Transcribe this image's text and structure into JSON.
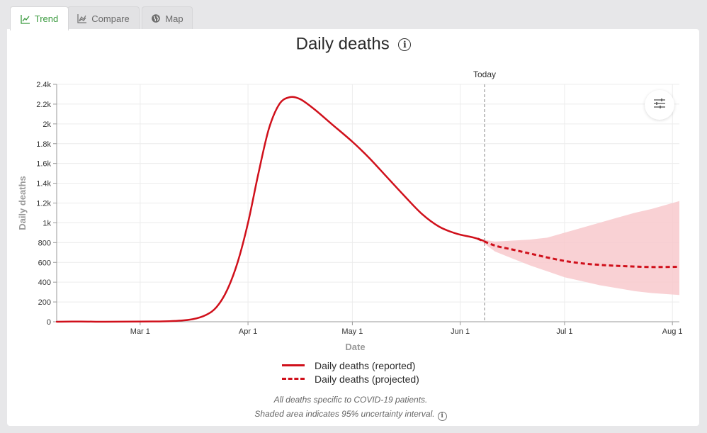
{
  "tabs": [
    {
      "label": "Trend",
      "icon": "line-chart-icon",
      "active": true
    },
    {
      "label": "Compare",
      "icon": "compare-chart-icon",
      "active": false
    },
    {
      "label": "Map",
      "icon": "globe-icon",
      "active": false
    }
  ],
  "title": "Daily deaths",
  "title_info_icon": "info-icon",
  "settings_icon": "sliders-icon",
  "footnotes": {
    "line1": "All deaths specific to COVID-19 patients.",
    "line2": "Shaded area indicates 95% uncertainty interval."
  },
  "colors": {
    "series": "#d0101b",
    "band": "#f8c9cc",
    "active_tab": "#3a9a3e"
  },
  "chart_data": {
    "type": "line",
    "title": "Daily deaths",
    "xlabel": "Date",
    "ylabel": "Daily deaths",
    "x_type": "date",
    "xlim": [
      "2020-02-06",
      "2020-08-03"
    ],
    "ylim": [
      0,
      2400
    ],
    "yticks": [
      0,
      200,
      400,
      600,
      800,
      1000,
      1200,
      1400,
      1600,
      1800,
      2000,
      2200,
      2400
    ],
    "ytick_labels": [
      "0",
      "200",
      "400",
      "600",
      "800",
      "1k",
      "1.2k",
      "1.4k",
      "1.6k",
      "1.8k",
      "2k",
      "2.2k",
      "2.4k"
    ],
    "xticks": [
      "2020-03-01",
      "2020-04-01",
      "2020-05-01",
      "2020-06-01",
      "2020-07-01",
      "2020-08-01"
    ],
    "xtick_labels": [
      "Mar 1",
      "Apr 1",
      "May 1",
      "Jun 1",
      "Jul 1",
      "Aug 1"
    ],
    "today": {
      "date": "2020-06-08",
      "label": "Today"
    },
    "grid": true,
    "legend_position": "bottom",
    "series": [
      {
        "name": "Daily deaths (reported)",
        "style": "solid",
        "points": [
          [
            "2020-02-06",
            0
          ],
          [
            "2020-02-13",
            2
          ],
          [
            "2020-02-20",
            0
          ],
          [
            "2020-03-01",
            2
          ],
          [
            "2020-03-06",
            3
          ],
          [
            "2020-03-11",
            8
          ],
          [
            "2020-03-16",
            25
          ],
          [
            "2020-03-20",
            70
          ],
          [
            "2020-03-23",
            150
          ],
          [
            "2020-03-26",
            320
          ],
          [
            "2020-03-29",
            600
          ],
          [
            "2020-04-01",
            1000
          ],
          [
            "2020-04-04",
            1500
          ],
          [
            "2020-04-07",
            1950
          ],
          [
            "2020-04-10",
            2200
          ],
          [
            "2020-04-13",
            2270
          ],
          [
            "2020-04-16",
            2250
          ],
          [
            "2020-04-20",
            2150
          ],
          [
            "2020-04-25",
            2000
          ],
          [
            "2020-05-01",
            1820
          ],
          [
            "2020-05-06",
            1650
          ],
          [
            "2020-05-11",
            1460
          ],
          [
            "2020-05-16",
            1270
          ],
          [
            "2020-05-21",
            1090
          ],
          [
            "2020-05-26",
            960
          ],
          [
            "2020-05-31",
            890
          ],
          [
            "2020-06-05",
            850
          ],
          [
            "2020-06-08",
            815
          ]
        ]
      },
      {
        "name": "Daily deaths (projected)",
        "style": "dashed",
        "points": [
          [
            "2020-06-06",
            840
          ],
          [
            "2020-06-11",
            770
          ],
          [
            "2020-06-16",
            730
          ],
          [
            "2020-06-21",
            690
          ],
          [
            "2020-06-26",
            650
          ],
          [
            "2020-07-01",
            615
          ],
          [
            "2020-07-06",
            590
          ],
          [
            "2020-07-11",
            575
          ],
          [
            "2020-07-16",
            565
          ],
          [
            "2020-07-21",
            558
          ],
          [
            "2020-07-26",
            553
          ],
          [
            "2020-08-03",
            555
          ]
        ]
      }
    ],
    "uncertainty_band": {
      "upper": [
        [
          "2020-06-06",
          840
        ],
        [
          "2020-06-11",
          810
        ],
        [
          "2020-06-16",
          820
        ],
        [
          "2020-06-21",
          830
        ],
        [
          "2020-06-26",
          850
        ],
        [
          "2020-07-01",
          900
        ],
        [
          "2020-07-06",
          950
        ],
        [
          "2020-07-11",
          1000
        ],
        [
          "2020-07-16",
          1050
        ],
        [
          "2020-07-21",
          1100
        ],
        [
          "2020-07-26",
          1140
        ],
        [
          "2020-08-03",
          1220
        ]
      ],
      "lower": [
        [
          "2020-06-06",
          840
        ],
        [
          "2020-06-11",
          710
        ],
        [
          "2020-06-16",
          640
        ],
        [
          "2020-06-21",
          570
        ],
        [
          "2020-06-26",
          510
        ],
        [
          "2020-07-01",
          450
        ],
        [
          "2020-07-06",
          410
        ],
        [
          "2020-07-11",
          370
        ],
        [
          "2020-07-16",
          340
        ],
        [
          "2020-07-21",
          310
        ],
        [
          "2020-07-26",
          290
        ],
        [
          "2020-08-03",
          270
        ]
      ]
    }
  }
}
